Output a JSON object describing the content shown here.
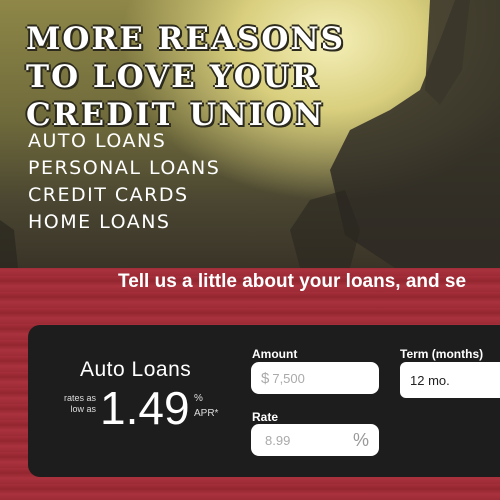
{
  "hero": {
    "headline_lines": [
      "MORE REASONS",
      "TO LOVE YOUR",
      "CREDIT UNION"
    ],
    "loan_types": [
      "AUTO LOANS",
      "PERSONAL LOANS",
      "CREDIT CARDS",
      "HOME LOANS"
    ]
  },
  "calculator": {
    "tagline": "Tell us a little about your loans, and se",
    "product_title": "Auto Loans",
    "rates_note": "rates as low as",
    "rate_value": "1.49",
    "rate_percent": "%",
    "rate_apr": "APR*",
    "amount_label": "Amount",
    "amount_prefix": "$",
    "amount_placeholder": "7,500",
    "term_label": "Term (months)",
    "term_value": "12 mo.",
    "rate_label": "Rate",
    "rate_placeholder": "8.99",
    "rate_suffix": "%"
  },
  "colors": {
    "band_red": "#a52f3a",
    "panel_dark": "#1d1d1d"
  }
}
